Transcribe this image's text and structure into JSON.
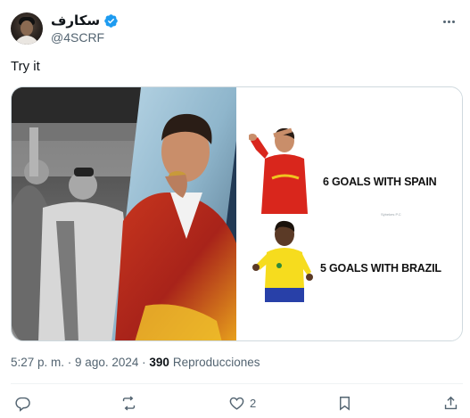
{
  "author": {
    "display_name": "سكارف",
    "handle": "@4SCRF",
    "verified": true
  },
  "tweet": {
    "text": "Try it"
  },
  "media": {
    "line1": "6 GOALS WITH SPAIN",
    "line2": "5 GOALS WITH BRAZIL",
    "watermark": "Sýbekes P.C"
  },
  "meta": {
    "time": "5:27 p. m.",
    "separator": " · ",
    "date": "9 ago. 2024",
    "views_count": "390",
    "views_label": "Reproducciones"
  },
  "actions": {
    "reply_count": "",
    "retweet_count": "",
    "like_count": "2",
    "bookmark_count": ""
  },
  "colors": {
    "verified": "#1d9bf0",
    "muted": "#536471",
    "border": "#cfd9de"
  },
  "icons": [
    "verified-badge-icon",
    "more-icon",
    "reply-icon",
    "retweet-icon",
    "like-icon",
    "bookmark-icon",
    "share-icon"
  ]
}
